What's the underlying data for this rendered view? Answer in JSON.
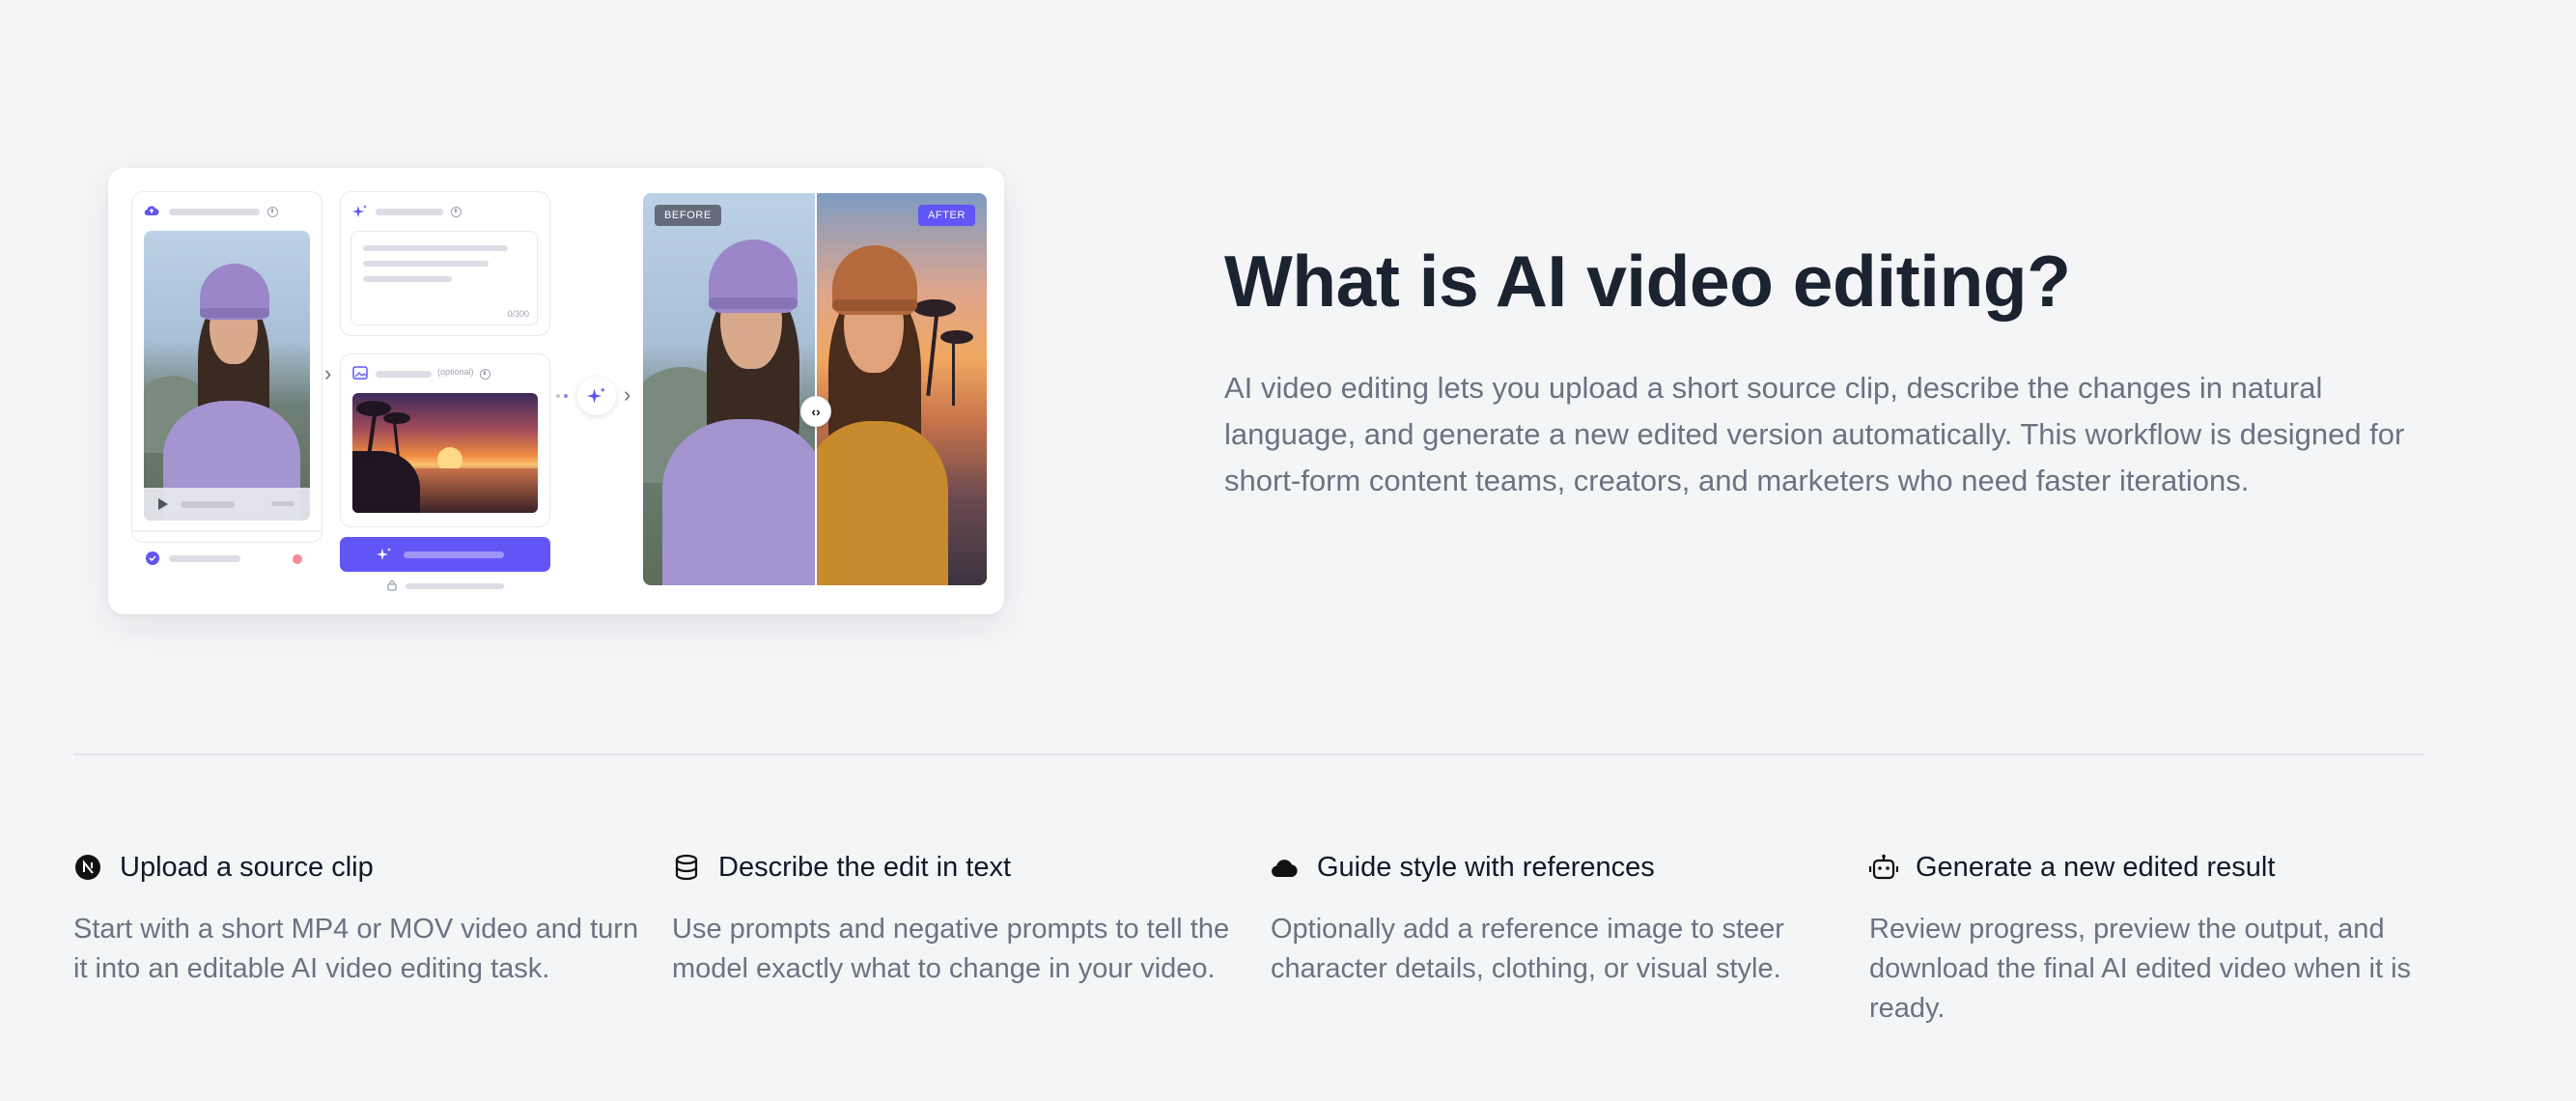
{
  "mockup": {
    "prompt_counter": "0/300",
    "reference_optional": "(optional)",
    "before_label": "BEFORE",
    "after_label": "AFTER"
  },
  "intro": {
    "heading": "What is AI video editing?",
    "description": "AI video editing lets you upload a short source clip, describe the changes in natural language, and generate a new edited version automatically. This workflow is designed for short-form content teams, creators, and marketers who need faster iterations."
  },
  "features": [
    {
      "icon": "nextjs-icon",
      "title": "Upload a source clip",
      "description": "Start with a short MP4 or MOV video and turn it into an editable AI video editing task."
    },
    {
      "icon": "database-icon",
      "title": "Describe the edit in text",
      "description": "Use prompts and negative prompts to tell the model exactly what to change in your video."
    },
    {
      "icon": "cloud-icon",
      "title": "Guide style with references",
      "description": "Optionally add a reference image to steer character details, clothing, or visual style."
    },
    {
      "icon": "robot-icon",
      "title": "Generate a new edited result",
      "description": "Review progress, preview the output, and download the final AI edited video when it is ready."
    }
  ],
  "colors": {
    "accent": "#6155f5",
    "heading": "#1b2230",
    "body_text": "#6b7280",
    "background": "#f4f5f7"
  }
}
